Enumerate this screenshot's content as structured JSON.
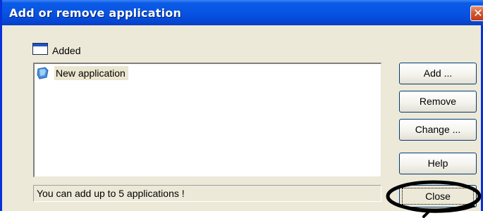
{
  "window": {
    "title": "Add or remove application",
    "close_glyph": "✕",
    "title_bar_color": "#0854e3"
  },
  "group": {
    "icon": "window-icon",
    "label": "Added"
  },
  "list": {
    "items": [
      {
        "icon": "application-icon",
        "label": "New application"
      }
    ]
  },
  "buttons": {
    "add": "Add ...",
    "remove": "Remove",
    "change": "Change ...",
    "help": "Help",
    "close": "Close"
  },
  "status": {
    "text": "You can add up to 5 applications !"
  },
  "annotation": {
    "type": "hand-drawn-ellipse",
    "color": "#000000"
  }
}
